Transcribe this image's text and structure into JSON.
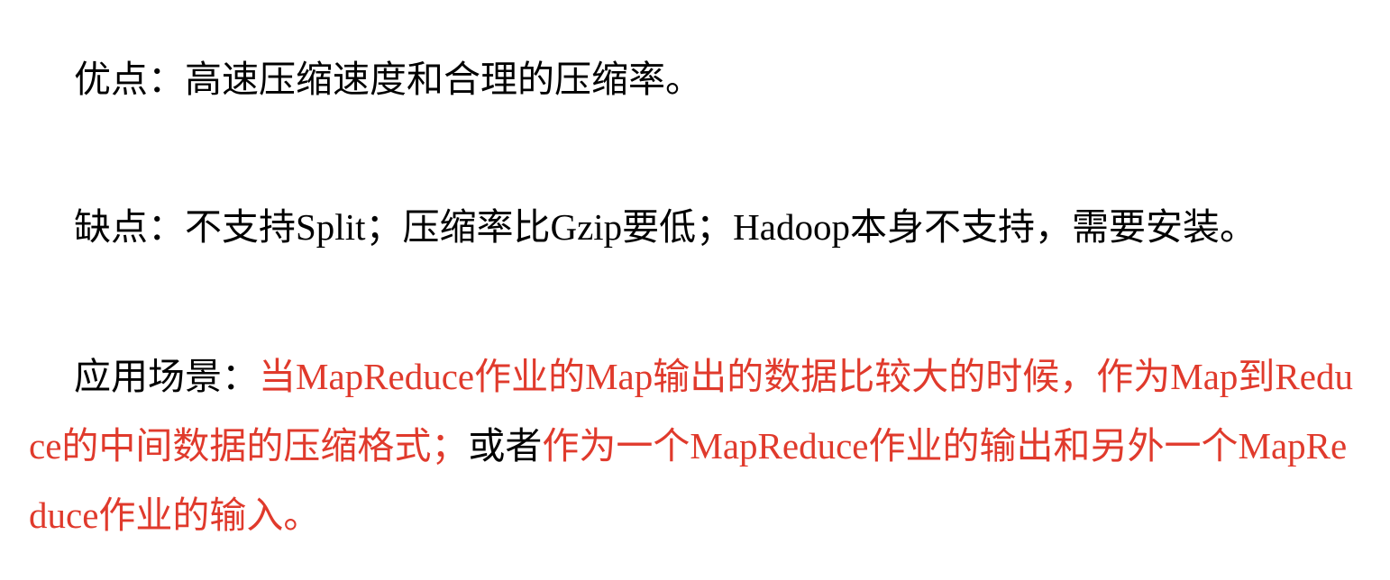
{
  "pros": {
    "label": "优点：",
    "text": "高速压缩速度和合理的压缩率。"
  },
  "cons": {
    "label": "缺点：",
    "text": "不支持Split；压缩率比Gzip要低；Hadoop本身不支持，需要安装。"
  },
  "scenarios": {
    "label": "应用场景：",
    "part1": "当MapReduce作业的Map输出的数据比较大的时候，作为Map到Reduce的中间数据的压缩格式；",
    "part2": "或者",
    "part3": "作为一个MapReduce作业的输出和另外一个MapReduce作业的输入。"
  },
  "colors": {
    "highlight": "#e03a2c",
    "text": "#000000"
  }
}
